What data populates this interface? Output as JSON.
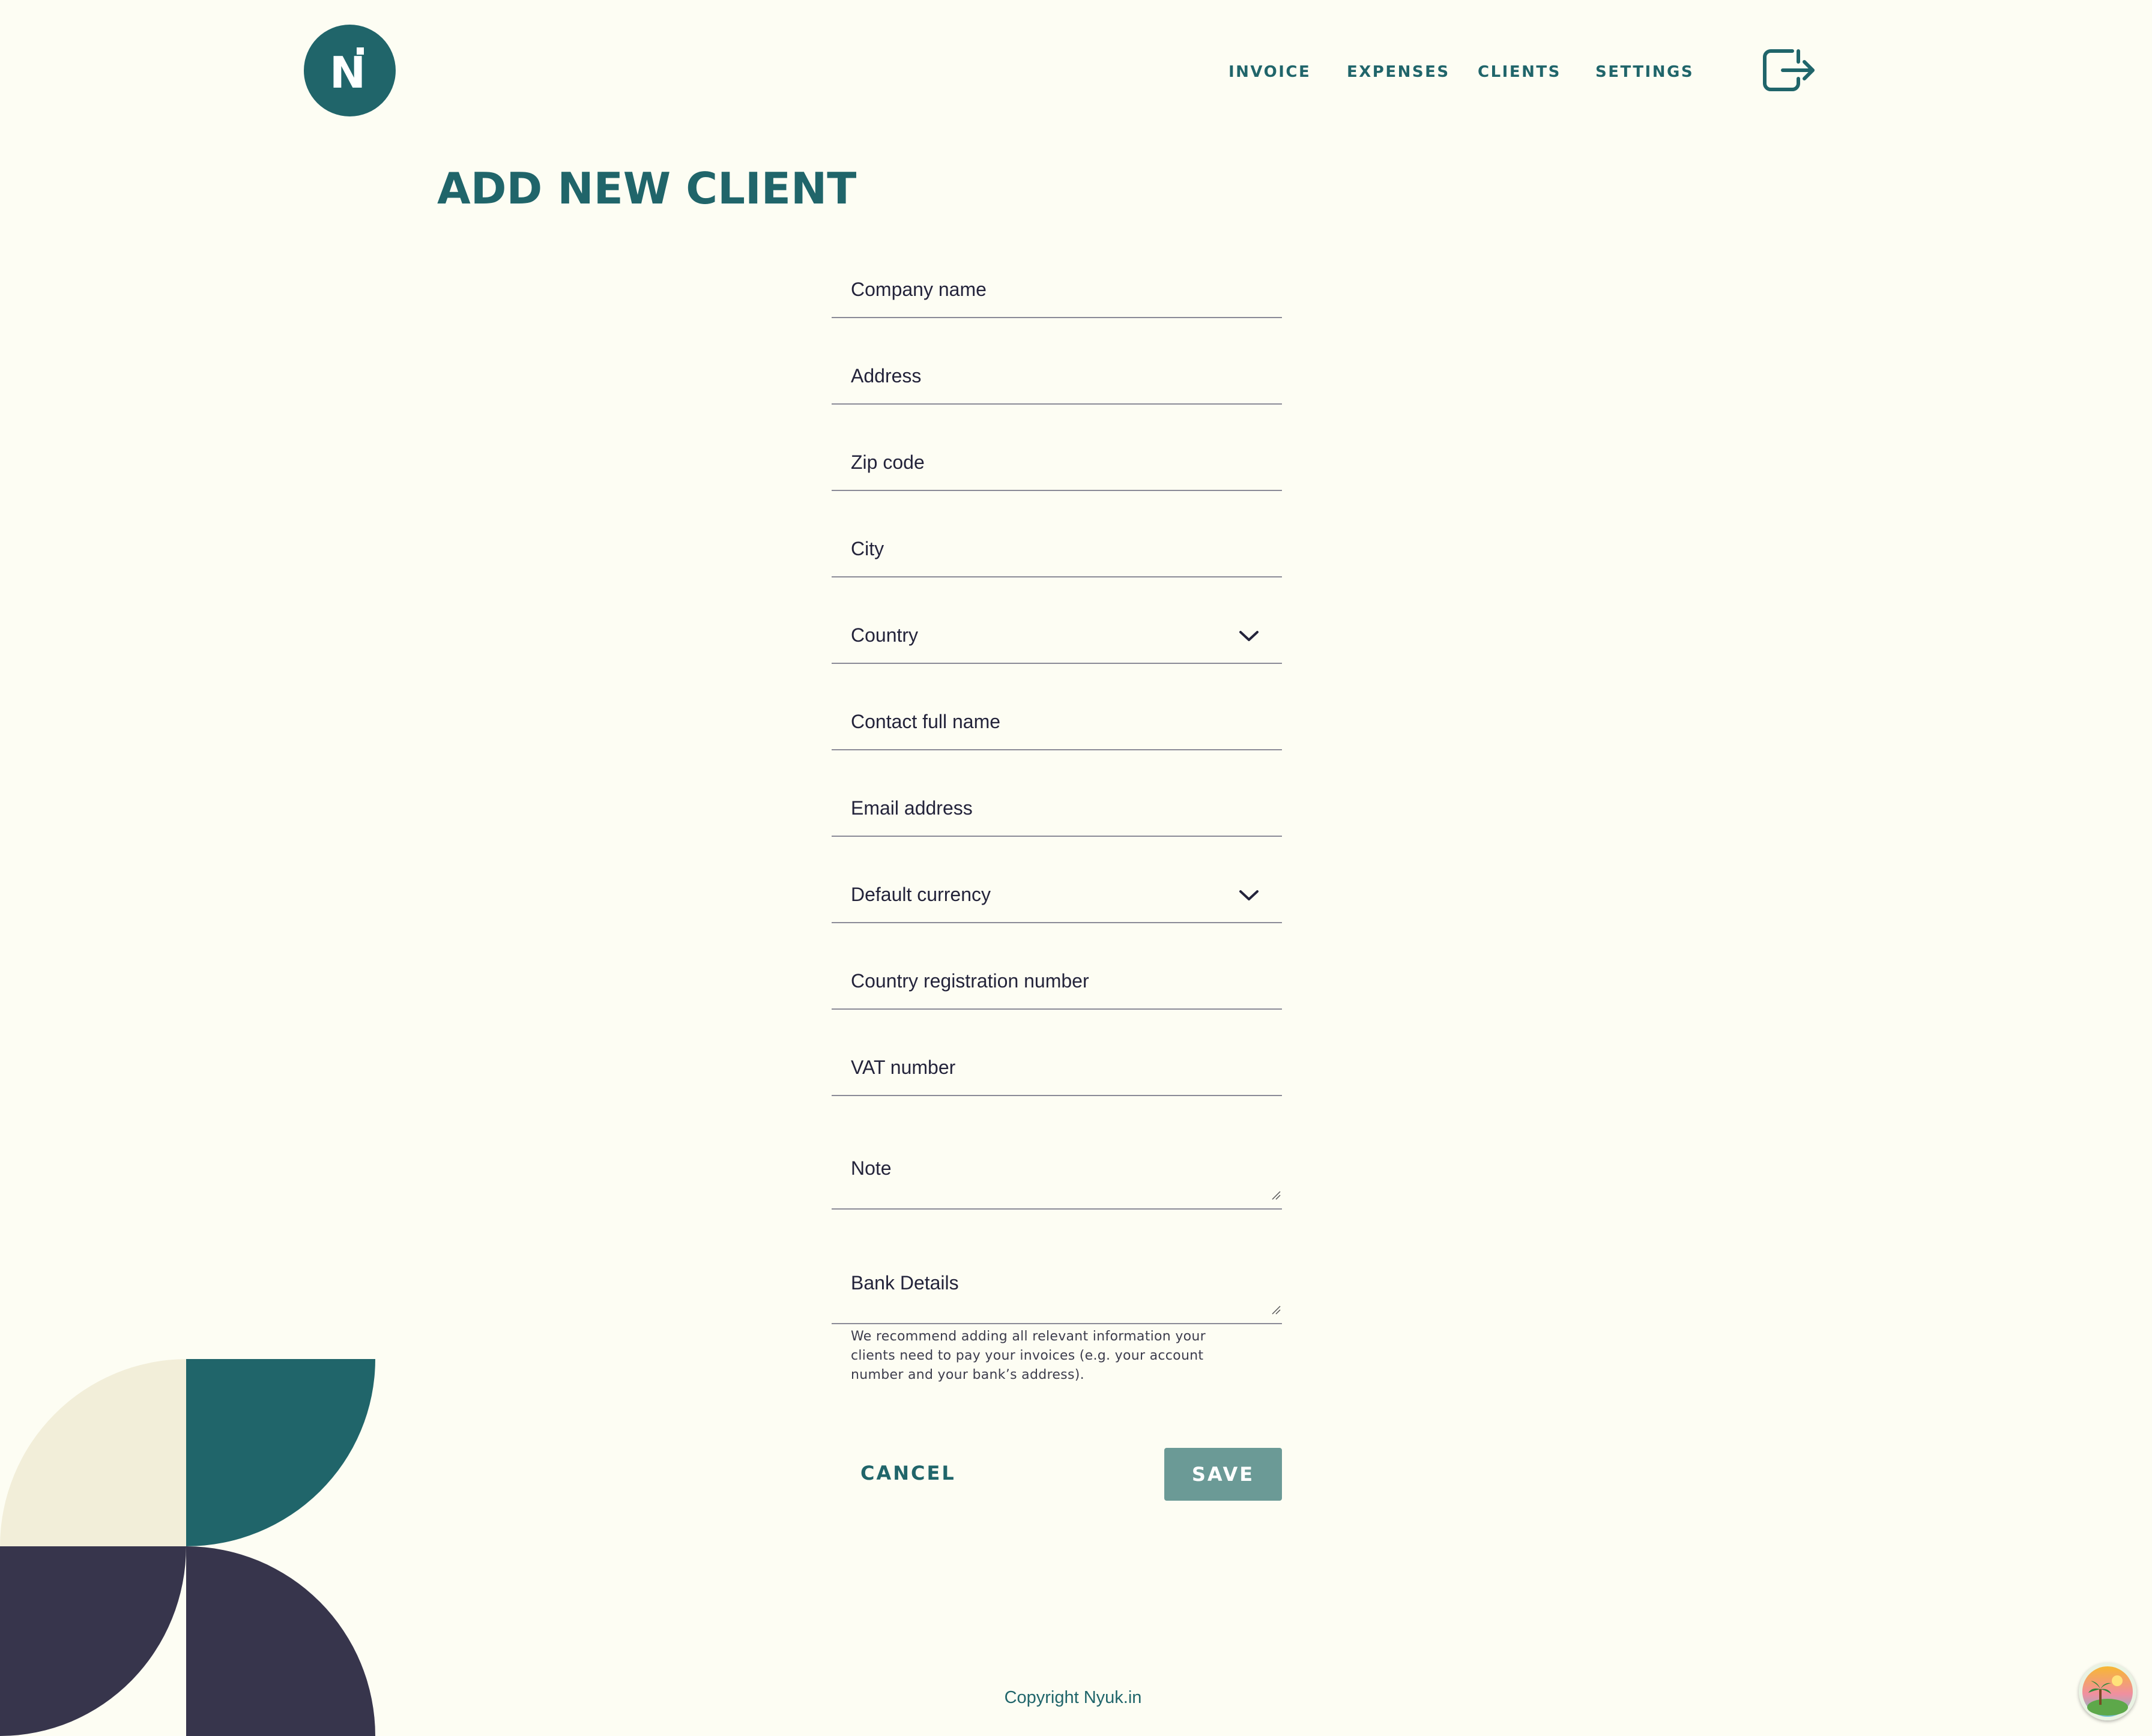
{
  "brand": {
    "logo_text": "N",
    "accent": "#20656a",
    "background": "#fdfdf3"
  },
  "nav": {
    "items": [
      {
        "label": "INVOICE"
      },
      {
        "label": "EXPENSES"
      },
      {
        "label": "CLIENTS"
      },
      {
        "label": "SETTINGS"
      }
    ],
    "logout_icon": "logout-icon"
  },
  "page": {
    "title": "ADD NEW CLIENT"
  },
  "form": {
    "company_name": {
      "placeholder": "Company name",
      "value": ""
    },
    "address": {
      "placeholder": "Address",
      "value": ""
    },
    "zip_code": {
      "placeholder": "Zip code",
      "value": ""
    },
    "city": {
      "placeholder": "City",
      "value": ""
    },
    "country": {
      "label": "Country",
      "icon": "chevron-down-icon"
    },
    "contact_name": {
      "placeholder": "Contact full name",
      "value": ""
    },
    "email": {
      "placeholder": "Email address",
      "value": ""
    },
    "default_currency": {
      "label": "Default currency",
      "icon": "chevron-down-icon"
    },
    "registration_number": {
      "placeholder": "Country registration number",
      "value": ""
    },
    "vat_number": {
      "placeholder": "VAT number",
      "value": ""
    },
    "note": {
      "placeholder": "Note",
      "value": ""
    },
    "bank_details": {
      "placeholder": "Bank Details",
      "value": "",
      "hint": "We recommend adding all relevant information your clients need to pay your invoices (e.g. your account number and your bank’s address)."
    },
    "cancel_label": "CANCEL",
    "save_label": "SAVE"
  },
  "footer": {
    "copyright": "Copyright Nyuk.in"
  },
  "decor_colors": {
    "cream": "#f2eed9",
    "teal": "#20656a",
    "navy": "#37354c"
  },
  "floating_button": {
    "icon": "island-avatar-icon"
  }
}
